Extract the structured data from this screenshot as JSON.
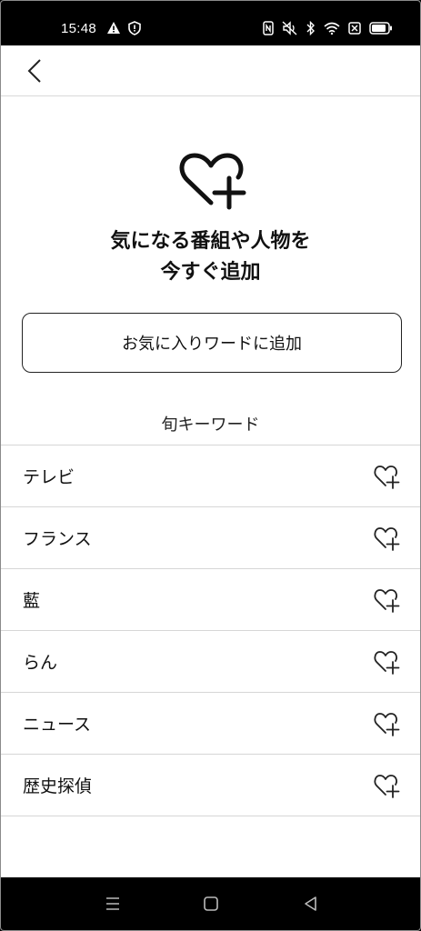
{
  "status_bar": {
    "time": "15:48",
    "left_icons": [
      "warning-icon",
      "shield-icon"
    ],
    "right_icons": [
      "nfc-icon",
      "mute-icon",
      "bluetooth-icon",
      "wifi-icon",
      "data-saver-icon",
      "battery-icon"
    ]
  },
  "header": {
    "back_icon": "chevron-left-icon"
  },
  "hero": {
    "icon": "heart-plus-icon",
    "title_line1": "気になる番組や人物を",
    "title_line2": "今すぐ追加"
  },
  "add_button": {
    "label": "お気に入りワードに追加"
  },
  "trending": {
    "heading": "旬キーワード",
    "items": [
      {
        "label": "テレビ"
      },
      {
        "label": "フランス"
      },
      {
        "label": "藍"
      },
      {
        "label": "らん"
      },
      {
        "label": "ニュース"
      },
      {
        "label": "歴史探偵"
      }
    ]
  },
  "nav_bar": {
    "buttons": [
      "menu-icon",
      "home-icon",
      "back-icon"
    ]
  },
  "colors": {
    "text": "#111111",
    "divider": "#d6d6d6",
    "bar": "#000000"
  }
}
